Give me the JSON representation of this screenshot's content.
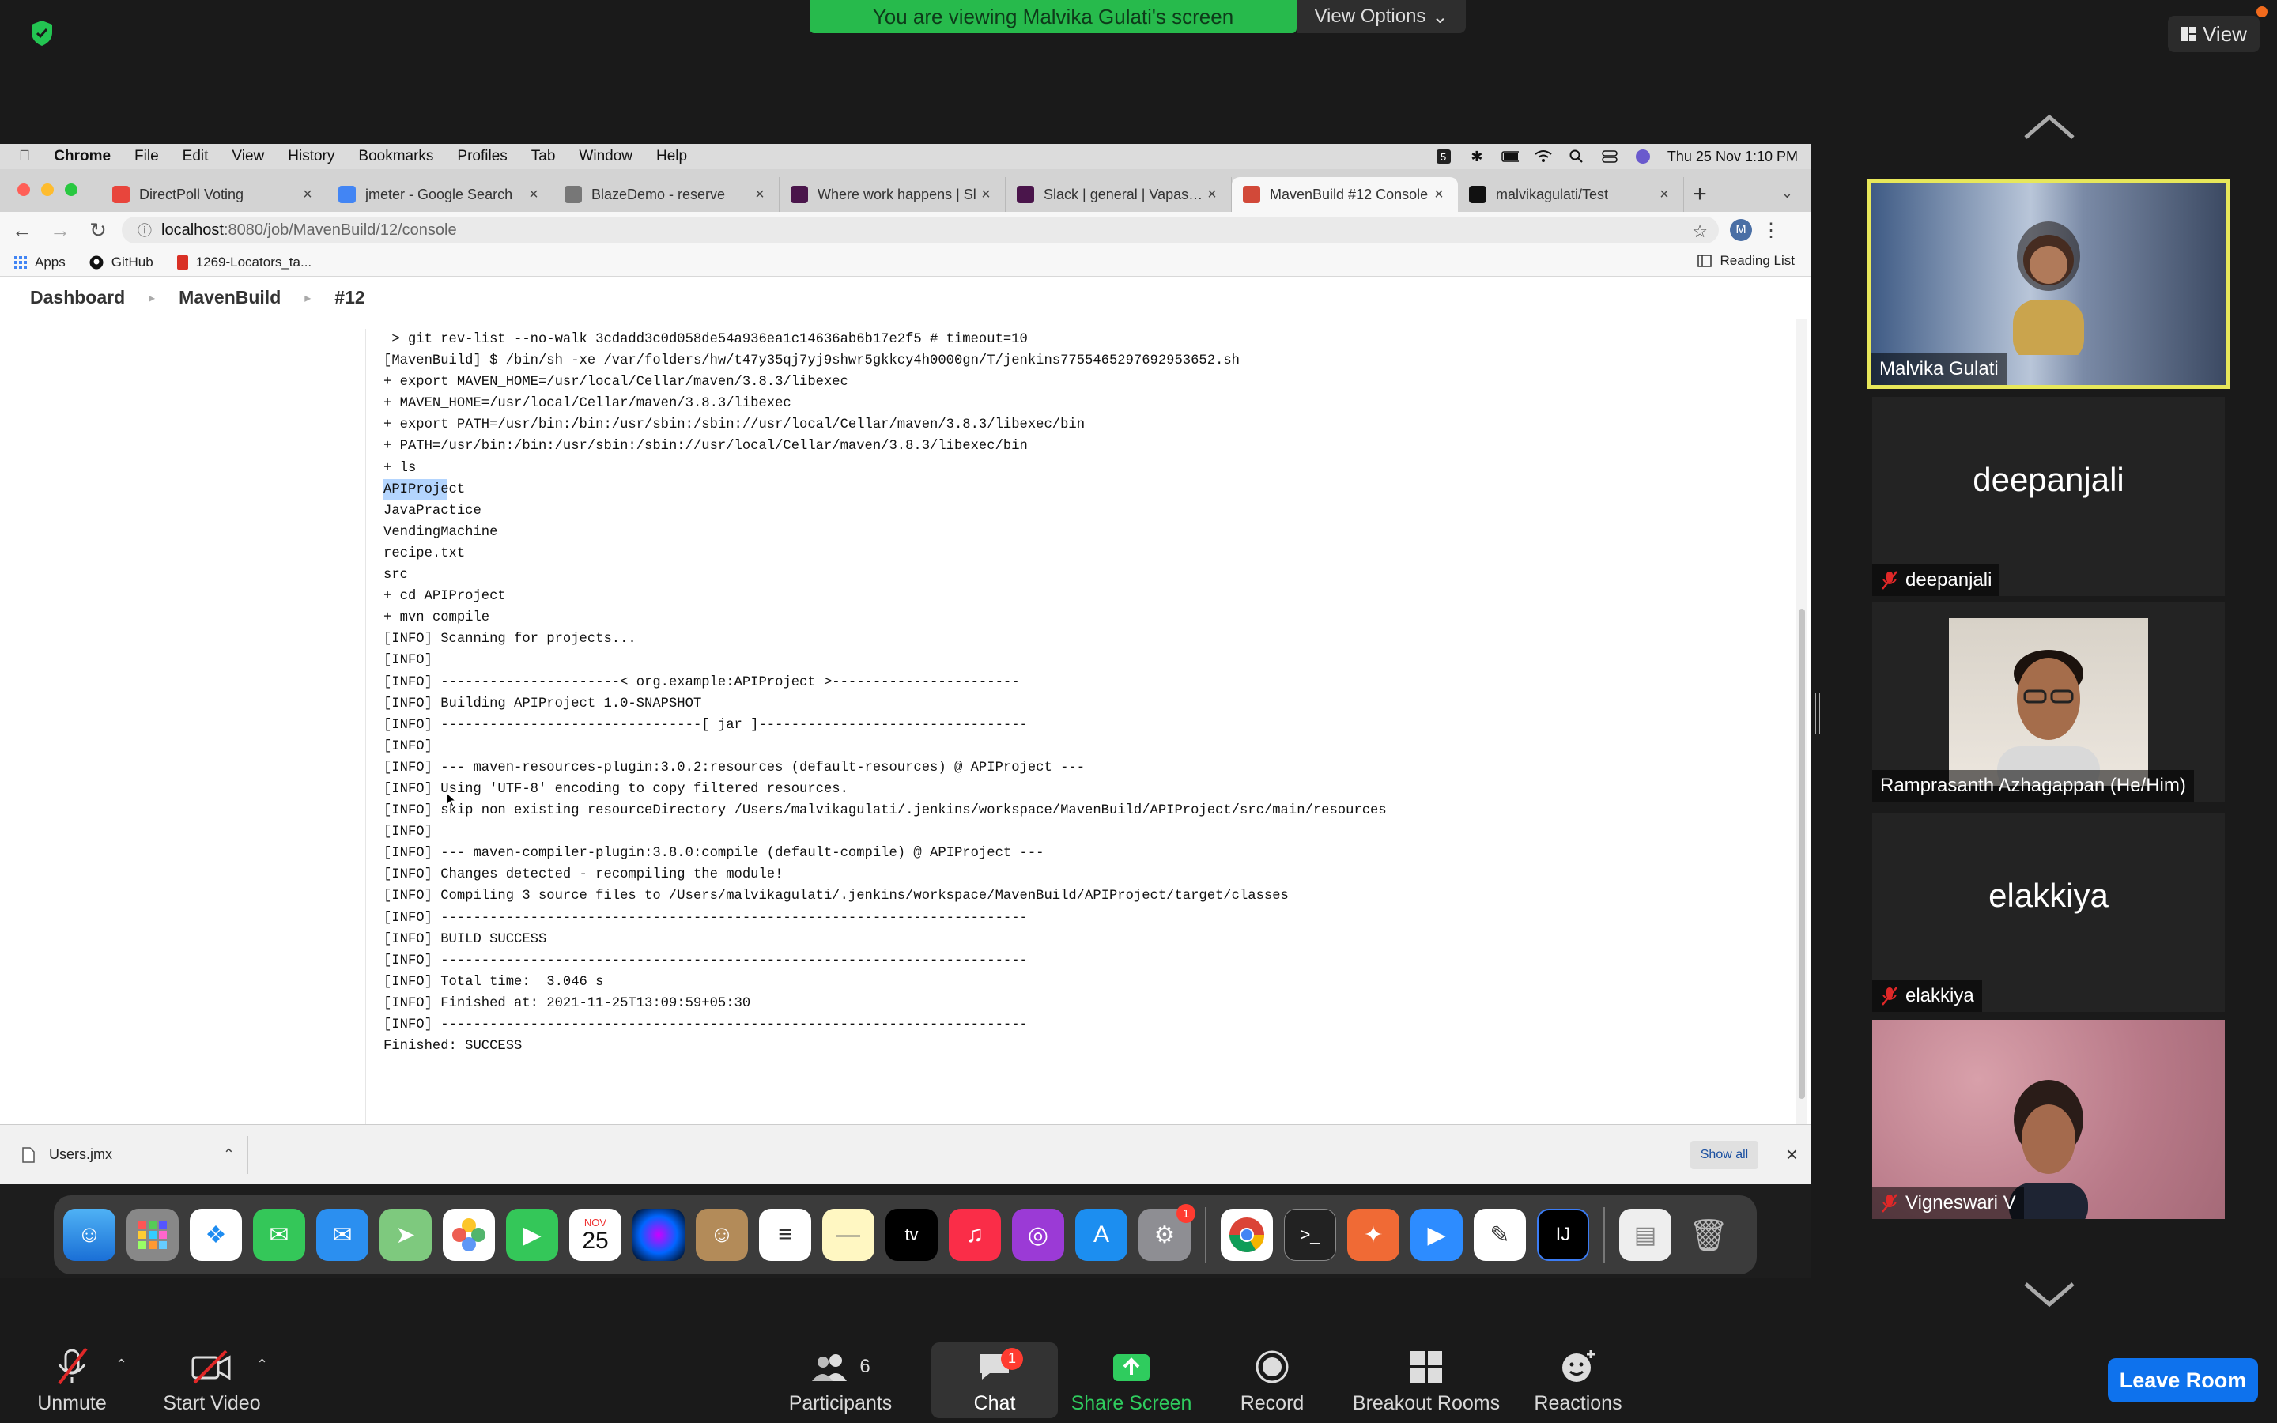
{
  "zoom": {
    "share_banner": "You are viewing Malvika Gulati's screen",
    "view_options": "View Options",
    "view_button": "View",
    "leave_button": "Leave Room",
    "toolbar": {
      "unmute": "Unmute",
      "start_video": "Start Video",
      "participants": "Participants",
      "participants_count": "6",
      "chat": "Chat",
      "chat_badge": "1",
      "share_screen": "Share Screen",
      "record": "Record",
      "breakout_rooms": "Breakout Rooms",
      "reactions": "Reactions"
    },
    "gallery": [
      {
        "name": "Malvika Gulati",
        "muted": false,
        "video": true,
        "active_speaker": true
      },
      {
        "name": "deepanjali",
        "muted": true,
        "video": false
      },
      {
        "name": "Ramprasanth Azhagappan (He/Him)",
        "muted": false,
        "video": true
      },
      {
        "name": "elakkiya",
        "muted": true,
        "video": false
      },
      {
        "name": "Vigneswari V",
        "muted": true,
        "video": true
      }
    ]
  },
  "mac": {
    "menubar": [
      "Chrome",
      "File",
      "Edit",
      "View",
      "History",
      "Bookmarks",
      "Profiles",
      "Tab",
      "Window",
      "Help"
    ],
    "clock": "Thu 25 Nov  1:10 PM"
  },
  "chrome": {
    "tabs": [
      {
        "title": "DirectPoll Voting",
        "favicon": "directpoll-icon",
        "color": "#e8453c"
      },
      {
        "title": "jmeter - Google Search",
        "favicon": "google-icon",
        "color": "#4285f4"
      },
      {
        "title": "BlazeDemo - reserve",
        "favicon": "globe-icon",
        "color": "#777777"
      },
      {
        "title": "Where work happens | Sl",
        "favicon": "slack-icon",
        "color": "#4a154b"
      },
      {
        "title": "Slack | general | Vapasi Q",
        "favicon": "slack-icon",
        "color": "#4a154b"
      },
      {
        "title": "MavenBuild #12 Console",
        "favicon": "jenkins-icon",
        "color": "#d24939",
        "active": true
      },
      {
        "title": "malvikagulati/Test",
        "favicon": "github-icon",
        "color": "#111111"
      }
    ],
    "url_host": "localhost",
    "url_path": ":8080/job/MavenBuild/12/console",
    "profile_initial": "M",
    "bookmarks": [
      "Apps",
      "GitHub",
      "1269-Locators_ta..."
    ],
    "reading_list": "Reading List",
    "download_file": "Users.jmx",
    "show_all": "Show all"
  },
  "jenkins": {
    "breadcrumbs": [
      "Dashboard",
      "MavenBuild",
      "#12"
    ],
    "console_lines": [
      " > git rev-list --no-walk 3cdadd3c0d058de54a936ea1c14636ab6b17e2f5 # timeout=10",
      "[MavenBuild] $ /bin/sh -xe /var/folders/hw/t47y35qj7yj9shwr5gkkcy4h0000gn/T/jenkins7755465297692953652.sh",
      "+ export MAVEN_HOME=/usr/local/Cellar/maven/3.8.3/libexec",
      "+ MAVEN_HOME=/usr/local/Cellar/maven/3.8.3/libexec",
      "+ export PATH=/usr/bin:/bin:/usr/sbin:/sbin://usr/local/Cellar/maven/3.8.3/libexec/bin",
      "+ PATH=/usr/bin:/bin:/usr/sbin:/sbin://usr/local/Cellar/maven/3.8.3/libexec/bin",
      "+ ls",
      "APIProject",
      "JavaPractice",
      "VendingMachine",
      "recipe.txt",
      "src",
      "+ cd APIProject",
      "+ mvn compile",
      "[INFO] Scanning for projects...",
      "[INFO]",
      "[INFO] ----------------------< org.example:APIProject >-----------------------",
      "[INFO] Building APIProject 1.0-SNAPSHOT",
      "[INFO] --------------------------------[ jar ]---------------------------------",
      "[INFO]",
      "[INFO] --- maven-resources-plugin:3.0.2:resources (default-resources) @ APIProject ---",
      "[INFO] Using 'UTF-8' encoding to copy filtered resources.",
      "[INFO] skip non existing resourceDirectory /Users/malvikagulati/.jenkins/workspace/MavenBuild/APIProject/src/main/resources",
      "[INFO]",
      "[INFO] --- maven-compiler-plugin:3.8.0:compile (default-compile) @ APIProject ---",
      "[INFO] Changes detected - recompiling the module!",
      "[INFO] Compiling 3 source files to /Users/malvikagulati/.jenkins/workspace/MavenBuild/APIProject/target/classes",
      "[INFO] ------------------------------------------------------------------------",
      "[INFO] BUILD SUCCESS",
      "[INFO] ------------------------------------------------------------------------",
      "[INFO] Total time:  3.046 s",
      "[INFO] Finished at: 2021-11-25T13:09:59+05:30",
      "[INFO] ------------------------------------------------------------------------",
      "Finished: SUCCESS"
    ]
  },
  "dock": {
    "calendar_month": "NOV",
    "calendar_day": "25",
    "settings_badge": "1"
  }
}
